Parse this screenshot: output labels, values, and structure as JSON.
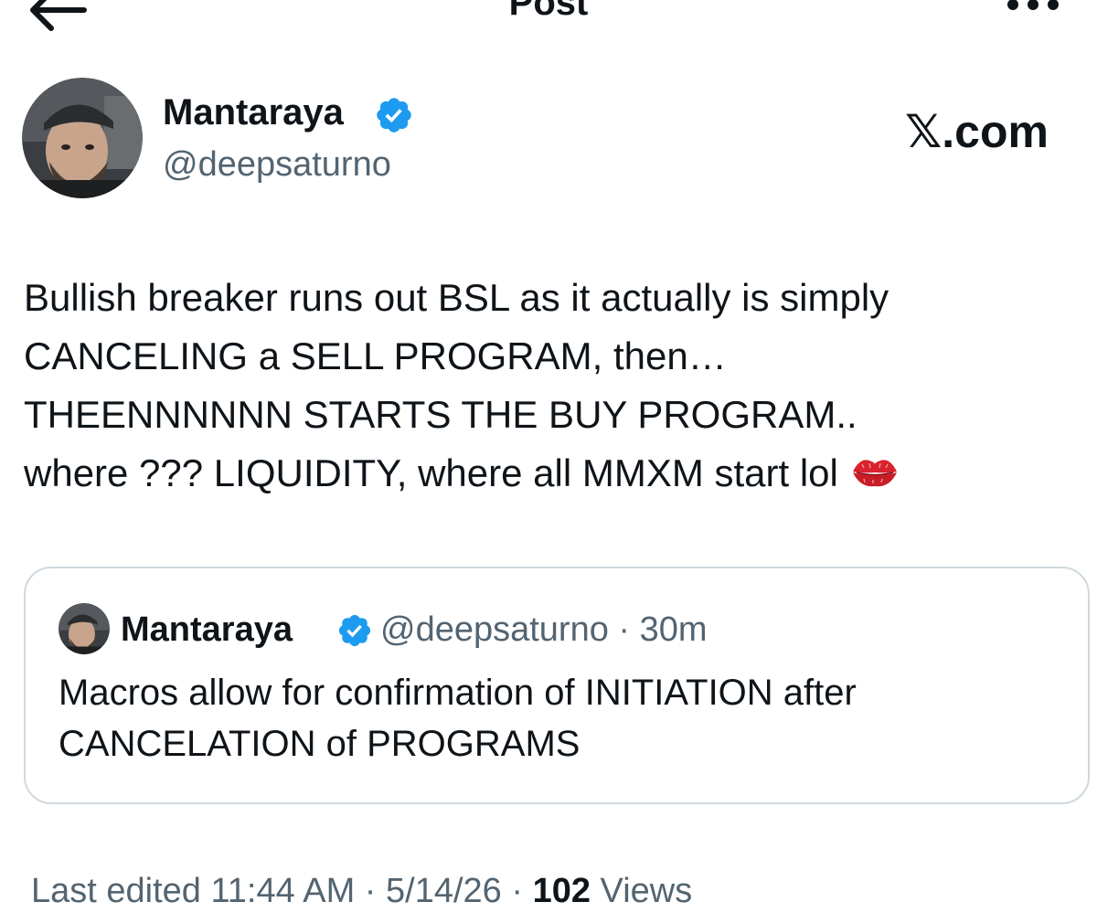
{
  "header": {
    "title": "Post",
    "back_icon": "arrow-left-icon",
    "more_icon": "more-horizontal-icon"
  },
  "author": {
    "name": "Mantaraya",
    "handle": "@deepsaturno",
    "verified_icon": "verified-badge-icon",
    "verified_color": "#1d9bf0"
  },
  "watermark": "𝕏.com",
  "post": {
    "lines": [
      "Bullish breaker runs out BSL as it actually is simply",
      "CANCELING a SELL PROGRAM, then…",
      "THEENNNNNN STARTS THE BUY PROGRAM..",
      "where ??? LIQUIDITY, where all MMXM start lol"
    ],
    "emoji_icon": "kiss-mark-icon"
  },
  "quote": {
    "name": "Mantaraya",
    "handle": "@deepsaturno",
    "separator": "·",
    "time": "30m",
    "lines": [
      "Macros allow for confirmation of INITIATION after",
      "CANCELATION of PROGRAMS"
    ]
  },
  "meta": {
    "edited_label": "Last edited",
    "time": "11:44 AM",
    "date": "5/14/26",
    "separator": "·",
    "views_count": "102",
    "views_label": "Views"
  },
  "colors": {
    "text_primary": "#0f1419",
    "text_secondary": "#536471",
    "border": "#cfd9de",
    "accent": "#1d9bf0",
    "emoji_red": "#d9232e"
  }
}
